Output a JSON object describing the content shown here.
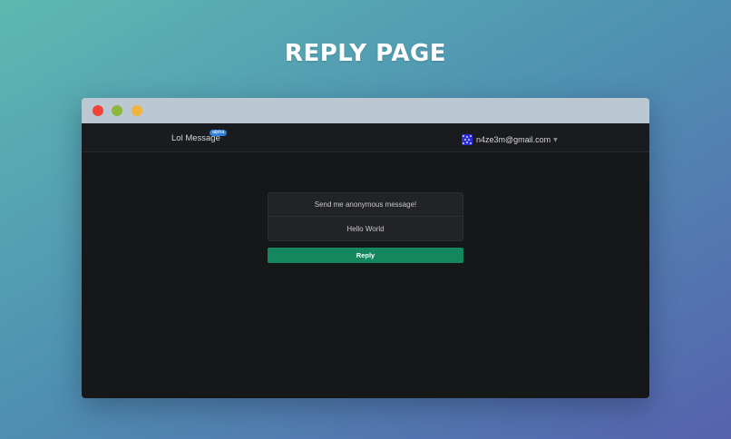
{
  "heading": "REPLY PAGE",
  "window": {
    "controls": [
      "close",
      "minimize",
      "maximize"
    ]
  },
  "navbar": {
    "brand": "Lol Message",
    "badge": "alpha",
    "user_email": "n4ze3m@gmail.com",
    "user_menu_icon": "chevron-down-icon"
  },
  "card": {
    "prompt": "Send me anonymous message!",
    "message": "Hello World"
  },
  "actions": {
    "reply_label": "Reply"
  },
  "colors": {
    "accent": "#14875e",
    "badge": "#2f7fd8",
    "app_bg": "#161719"
  }
}
